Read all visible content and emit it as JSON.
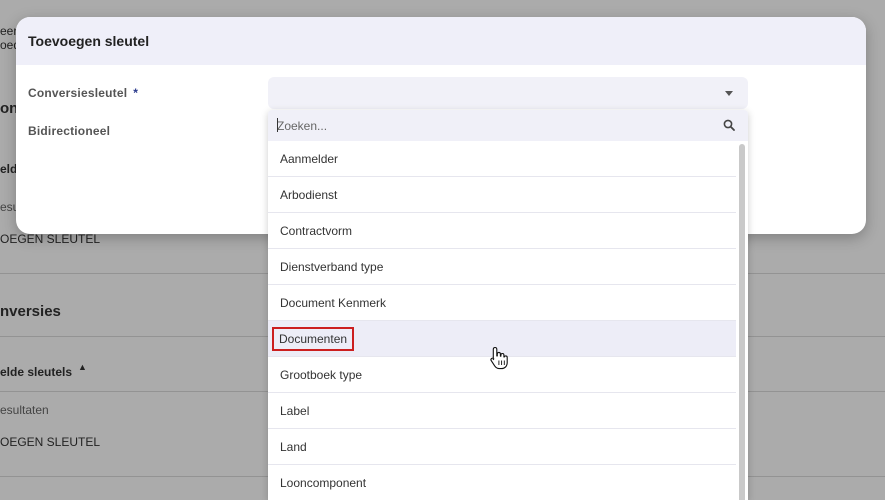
{
  "background": {
    "fragments": [
      "eer",
      "oed",
      "onv",
      "elde",
      "esul",
      "OEGEN SLEUTEL",
      "nversies",
      "elde sleutels",
      "esultaten",
      "OEGEN SLEUTEL"
    ]
  },
  "modal": {
    "title": "Toevoegen sleutel",
    "fields": {
      "conversion_key_label": "Conversiesleutel",
      "required_marker": "*",
      "bidirectional_label": "Bidirectioneel"
    }
  },
  "dropdown": {
    "search_placeholder": "Zoeken...",
    "options": [
      "Aanmelder",
      "Arbodienst",
      "Contractvorm",
      "Dienstverband type",
      "Document Kenmerk",
      "Documenten",
      "Grootboek type",
      "Label",
      "Land",
      "Looncomponent"
    ],
    "hovered_option": "Documenten"
  },
  "icons": {
    "caret": "chevron-down-icon",
    "search": "search-icon",
    "pointer": "hand-cursor-icon",
    "sort": "sort-up-icon"
  },
  "colors": {
    "header_bg": "#efeff9",
    "highlight_outline": "#cc1f1f",
    "required": "#2a3a8c"
  }
}
